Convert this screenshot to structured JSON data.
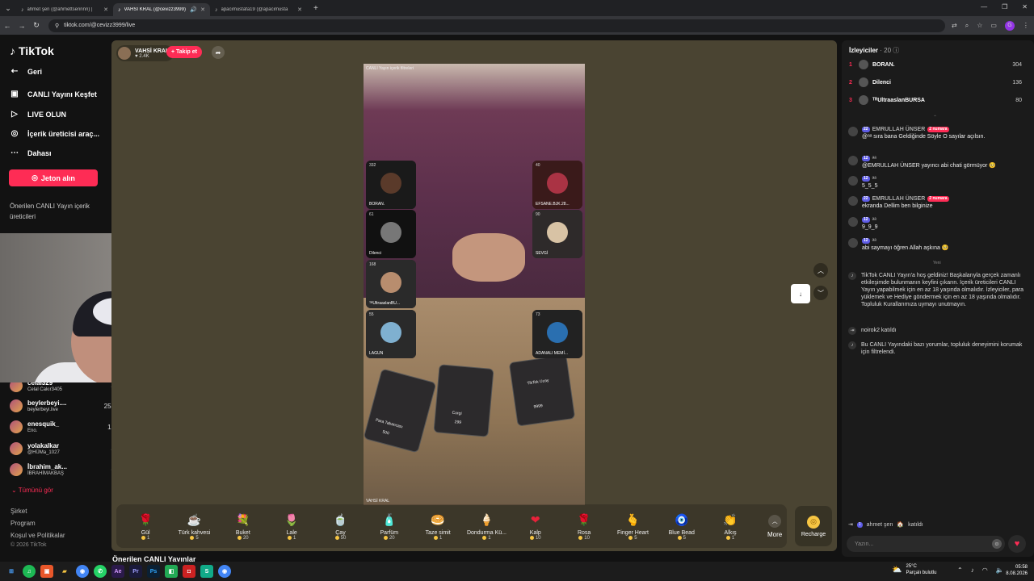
{
  "browser": {
    "tabs": [
      {
        "title": "ahmet şen (@ahmettsennnn) |",
        "active": false
      },
      {
        "title": "VAHSİ KRAL (@cevizz3999)",
        "active": true
      },
      {
        "title": "apacimustafa19 (@apacimusta",
        "active": false
      }
    ],
    "url": "tiktok.com/@cevizz3999/live",
    "profile_initial": "G"
  },
  "sidebar": {
    "logo": "TikTok",
    "nav": [
      {
        "label": "Geri",
        "icon": "back-arrow-icon"
      },
      {
        "label": "CANLI Yayını Keşfet",
        "icon": "live-tv-icon"
      },
      {
        "label": "LIVE OLUN",
        "icon": "video-camera-icon"
      },
      {
        "label": "İçerik üreticisi araç...",
        "icon": "lightbulb-icon"
      },
      {
        "label": "Dahası",
        "icon": "more-dots-icon"
      }
    ],
    "jeton_button": "Jeton alın",
    "suggested_title": "Önerilen CANLI Yayın içerik üreticileri",
    "streamers": [
      {
        "name": "celal329",
        "sub": "Celal Cakır3405",
        "count": "8"
      },
      {
        "name": "beylerbeyi....",
        "sub": "beylerbeyi.live",
        "count": "255"
      },
      {
        "name": "enesquik_",
        "sub": "Eno.",
        "count": "12"
      },
      {
        "name": "yolakalkar",
        "sub": "@HÜMa_1027",
        "count": "8"
      },
      {
        "name": "İbrahim_ak...",
        "sub": "İBRAHİMAKBAŞ",
        "count": "6"
      }
    ],
    "show_all": "Tümünü gör",
    "footer": [
      "Şirket",
      "Program",
      "Koşul ve Politikalar",
      "© 2026 TikTok"
    ]
  },
  "stream": {
    "creator_name": "VAHSİ KRAL",
    "likes": "2.4K",
    "follow_label": "+ Takip et",
    "video_caption_top": "CANLI Yayın içerik filtreleri",
    "video_caption_bottom": "VAHSİ KRAL",
    "guests": [
      {
        "name": "BORAN.",
        "num": "332"
      },
      {
        "name": "EFSANE.BJK.28...",
        "num": "40"
      },
      {
        "name": "Dilenci",
        "num": "61"
      },
      {
        "name": "SEVGİ",
        "num": "90"
      },
      {
        "name": "ᵀᴿUltraaslanBU...",
        "num": "168"
      },
      {
        "name": "LAGUN",
        "num": "55"
      },
      {
        "name": "ADANALI MEMİ...",
        "num": "73"
      }
    ],
    "cards": [
      {
        "label": "Para Tabancası",
        "price": "500"
      },
      {
        "label": "Corgi",
        "price": "299"
      },
      {
        "label": "TikTok Uzay",
        "price": "9999"
      }
    ]
  },
  "gifts": [
    {
      "name": "Gül",
      "price": "1",
      "icon": "rose-icon",
      "glyph": "🌹"
    },
    {
      "name": "Türk kahvesi",
      "price": "5",
      "icon": "coffee-icon",
      "glyph": "☕"
    },
    {
      "name": "Buket",
      "price": "20",
      "icon": "bouquet-icon",
      "glyph": "💐"
    },
    {
      "name": "Lale",
      "price": "1",
      "icon": "tulip-icon",
      "glyph": "🌷"
    },
    {
      "name": "Çay",
      "price": "50",
      "icon": "tea-icon",
      "glyph": "🍵"
    },
    {
      "name": "Parfüm",
      "price": "20",
      "icon": "perfume-icon",
      "glyph": "🧴"
    },
    {
      "name": "Taze simit",
      "price": "1",
      "icon": "simit-icon",
      "glyph": "🥯"
    },
    {
      "name": "Dondurma Kü...",
      "price": "1",
      "icon": "ice-cream-icon",
      "glyph": "🍦"
    },
    {
      "name": "Kalp",
      "price": "10",
      "icon": "heart-icon",
      "glyph": "❤"
    },
    {
      "name": "Rosa",
      "price": "10",
      "icon": "rosa-icon",
      "glyph": "🌹"
    },
    {
      "name": "Finger Heart",
      "price": "5",
      "icon": "finger-heart-icon",
      "glyph": "🫰"
    },
    {
      "name": "Blue Bead",
      "price": "5",
      "icon": "evil-eye-icon",
      "glyph": "🧿"
    },
    {
      "name": "Alkış",
      "price": "1",
      "icon": "clap-icon",
      "glyph": "👏"
    }
  ],
  "more_label": "More",
  "recharge_label": "Recharge",
  "bottom_title": "Önerilen CANLI Yayınlar",
  "viewers": {
    "title": "İzleyiciler",
    "count": "20",
    "list": [
      {
        "rank": "1",
        "name": "BORAN.",
        "score": "304"
      },
      {
        "rank": "2",
        "name": "Dilenci",
        "score": "136"
      },
      {
        "rank": "3",
        "name": "ᵀᴿUltraaslanBURSA",
        "score": "80"
      }
    ]
  },
  "chat": [
    {
      "user": "EMRULLAH ÜNSER",
      "level": "22",
      "badge": "2 numara",
      "text": "@ᵃᵃ sıra bana Geldiğinde Söyle O sayılar açılsın."
    },
    {
      "user": "ᵃᵃ",
      "level": "12",
      "badge": "",
      "text": "@EMRULLAH ÜNSER yayıncı abi chati görmüyor 🥺"
    },
    {
      "user": "ᵃᵃ",
      "level": "12",
      "badge": "",
      "text": "5_5_5"
    },
    {
      "user": "EMRULLAH ÜNSER",
      "level": "22",
      "badge": "2 numara",
      "text": "ekranda Dellim ben bilginize"
    },
    {
      "user": "ᵃᵃ",
      "level": "12",
      "badge": "",
      "text": "9_9_9"
    },
    {
      "user": "ᵃᵃ",
      "level": "12",
      "badge": "",
      "text": "abi saymayı öğren Allah aşkına 🥺"
    }
  ],
  "new_label": "Yeni",
  "system_messages": [
    {
      "text": "TikTok CANLI Yayın'a hoş geldiniz! Başkalarıyla gerçek zamanlı etkileşimde bulunmanın keyfini çıkarın. İçerik üreticileri CANLI Yayın yapabilmek için en az 18 yaşında olmalıdır. İzleyiciler, para yüklemek ve Hediye göndermek için en az 18 yaşında olmalıdır. Topluluk Kurallarımıza uymayı unutmayın."
    },
    {
      "text": "noirok2 katıldı"
    },
    {
      "text": "Bu CANLI Yayındaki bazı yorumlar, topluluk deneyimini korumak için filtrelendi."
    }
  ],
  "join_msg": {
    "level": "1",
    "user": "ahmet şen",
    "action": "katıldı"
  },
  "input_placeholder": "Yazın...",
  "taskbar": {
    "temp": "25°C",
    "weather": "Parçalı bulutlu",
    "time": "05:58",
    "date": "8.08.2026"
  }
}
